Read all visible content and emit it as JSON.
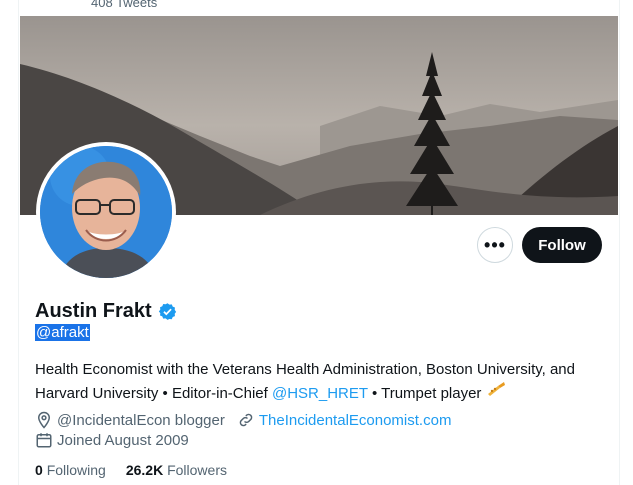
{
  "top": {
    "tweet_count": "408 Tweets"
  },
  "profile": {
    "name": "Austin Frakt",
    "handle": "@afrakt",
    "bio_text_1": "Health Economist with the Veterans Health Administration, Boston University, and Harvard University • Editor-in-Chief ",
    "bio_mention": "@HSR_HRET",
    "bio_text_2": " • Trumpet player ",
    "location": "@IncidentalEcon blogger",
    "website": "TheIncidentalEconomist.com",
    "joined": "Joined August 2009",
    "following_count": "0",
    "following_label": "Following",
    "followers_count": "26.2K",
    "followers_label": "Followers"
  },
  "actions": {
    "more_label": "•••",
    "follow_label": "Follow"
  },
  "icons": {
    "verified": "verified-badge-icon",
    "location": "location-pin-icon",
    "link": "link-icon",
    "calendar": "calendar-icon",
    "trumpet": "trumpet-icon"
  },
  "colors": {
    "accent": "#1d9bf0",
    "follow_bg": "#0f1419",
    "selection": "#1a73e8"
  }
}
